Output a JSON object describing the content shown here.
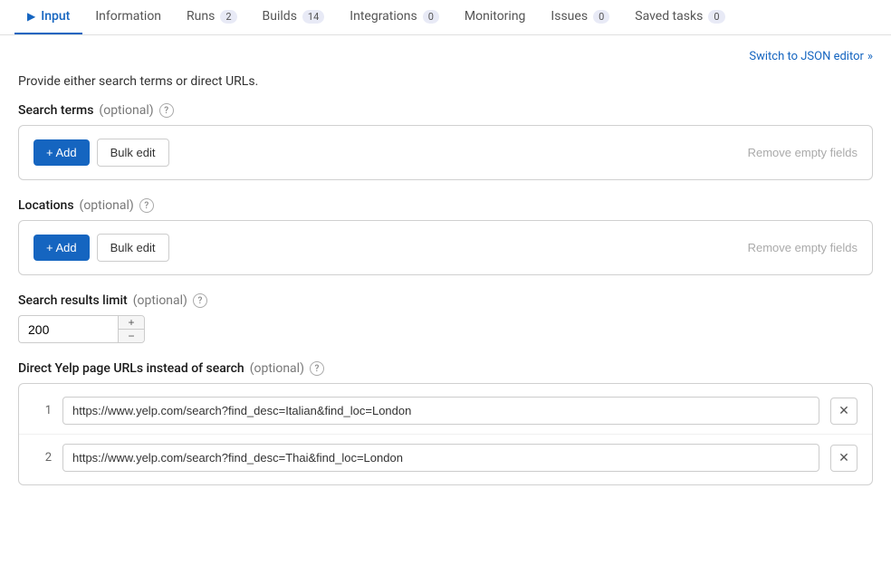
{
  "tabs": [
    {
      "id": "input",
      "label": "Input",
      "active": true,
      "badge": null,
      "hasPlay": true
    },
    {
      "id": "information",
      "label": "Information",
      "active": false,
      "badge": null,
      "hasPlay": false
    },
    {
      "id": "runs",
      "label": "Runs",
      "active": false,
      "badge": "2",
      "hasPlay": false
    },
    {
      "id": "builds",
      "label": "Builds",
      "active": false,
      "badge": "14",
      "hasPlay": false
    },
    {
      "id": "integrations",
      "label": "Integrations",
      "active": false,
      "badge": "0",
      "hasPlay": false
    },
    {
      "id": "monitoring",
      "label": "Monitoring",
      "active": false,
      "badge": null,
      "hasPlay": false
    },
    {
      "id": "issues",
      "label": "Issues",
      "active": false,
      "badge": "0",
      "hasPlay": false
    },
    {
      "id": "saved-tasks",
      "label": "Saved tasks",
      "active": false,
      "badge": "0",
      "hasPlay": false
    }
  ],
  "switch_link_label": "Switch to JSON editor",
  "description": "Provide either search terms or direct URLs.",
  "search_terms": {
    "label": "Search terms",
    "optional_text": "(optional)",
    "add_label": "+ Add",
    "bulk_edit_label": "Bulk edit",
    "remove_empty_label": "Remove empty fields"
  },
  "locations": {
    "label": "Locations",
    "optional_text": "(optional)",
    "add_label": "+ Add",
    "bulk_edit_label": "Bulk edit",
    "remove_empty_label": "Remove empty fields"
  },
  "search_results_limit": {
    "label": "Search results limit",
    "optional_text": "(optional)",
    "value": "200"
  },
  "direct_urls": {
    "label": "Direct Yelp page URLs instead of search",
    "optional_text": "(optional)",
    "urls": [
      {
        "num": 1,
        "value": "https://www.yelp.com/search?find_desc=Italian&find_loc=London"
      },
      {
        "num": 2,
        "value": "https://www.yelp.com/search?find_desc=Thai&find_loc=London"
      }
    ]
  }
}
